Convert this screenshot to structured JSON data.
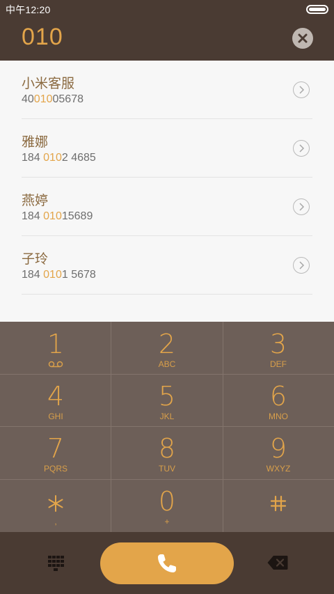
{
  "status_bar": {
    "time": "中午12:20"
  },
  "header": {
    "dialed_number": "010"
  },
  "contacts": [
    {
      "name": "小米客服",
      "number_pre": "40",
      "number_match": "010",
      "number_post": "05678"
    },
    {
      "name": "雅娜",
      "number_pre": "184 ",
      "number_match": "010",
      "number_post": "2 4685"
    },
    {
      "name": "燕婷",
      "number_pre": "184 ",
      "number_match": "010",
      "number_post": "15689"
    },
    {
      "name": "子玲",
      "number_pre": "184 ",
      "number_match": "010",
      "number_post": "1 5678"
    }
  ],
  "keypad": {
    "k1": {
      "digit": "1",
      "sub": ""
    },
    "k2": {
      "digit": "2",
      "sub": "ABC"
    },
    "k3": {
      "digit": "3",
      "sub": "DEF"
    },
    "k4": {
      "digit": "4",
      "sub": "GHI"
    },
    "k5": {
      "digit": "5",
      "sub": "JKL"
    },
    "k6": {
      "digit": "6",
      "sub": "MNO"
    },
    "k7": {
      "digit": "7",
      "sub": "PQRS"
    },
    "k8": {
      "digit": "8",
      "sub": "TUV"
    },
    "k9": {
      "digit": "9",
      "sub": "WXYZ"
    },
    "kstar": {
      "digit": "",
      "sub": ","
    },
    "k0": {
      "digit": "0",
      "sub": "+"
    },
    "khash": {
      "digit": "",
      "sub": ""
    }
  },
  "icons": {
    "clear": "close-icon",
    "arrow": "chevron-right-icon",
    "voicemail": "voicemail-icon",
    "star": "asterisk-icon",
    "hash": "hash-icon",
    "dialpad": "dialpad-icon",
    "call": "phone-icon",
    "backspace": "backspace-icon"
  },
  "colors": {
    "accent": "#e3a54a",
    "header_bg": "#4a3b33",
    "keypad_bg": "#6d5f58",
    "list_bg": "#f7f7f7"
  }
}
